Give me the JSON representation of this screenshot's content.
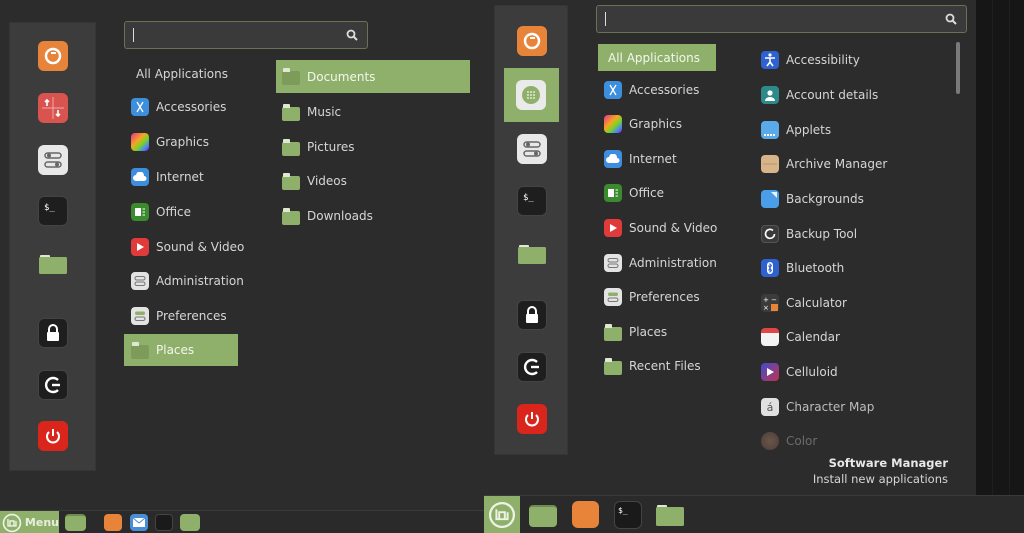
{
  "left_menu": {
    "search": {
      "value": "",
      "placeholder": ""
    },
    "favorites": [
      {
        "name": "firefox"
      },
      {
        "name": "update-manager"
      },
      {
        "name": "system-settings"
      },
      {
        "name": "terminal"
      },
      {
        "name": "files"
      },
      {
        "name": "lock-screen"
      },
      {
        "name": "logout"
      },
      {
        "name": "shutdown"
      }
    ],
    "categories": [
      {
        "label": "All Applications",
        "icon": "none"
      },
      {
        "label": "Accessories",
        "icon": "scissors-icon"
      },
      {
        "label": "Graphics",
        "icon": "graphics-icon"
      },
      {
        "label": "Internet",
        "icon": "cloud-icon"
      },
      {
        "label": "Office",
        "icon": "office-icon"
      },
      {
        "label": "Sound & Video",
        "icon": "play-icon"
      },
      {
        "label": "Administration",
        "icon": "toggles-icon"
      },
      {
        "label": "Preferences",
        "icon": "preferences-icon"
      },
      {
        "label": "Places",
        "icon": "folder-icon",
        "selected": true
      }
    ],
    "places": [
      {
        "label": "Documents",
        "selected": true
      },
      {
        "label": "Music"
      },
      {
        "label": "Pictures"
      },
      {
        "label": "Videos"
      },
      {
        "label": "Downloads"
      }
    ]
  },
  "left_taskbar": {
    "menu_label": "Menu"
  },
  "right_menu": {
    "search": {
      "value": "",
      "placeholder": ""
    },
    "categories": [
      {
        "label": "All Applications",
        "selected": true
      },
      {
        "label": "Accessories"
      },
      {
        "label": "Graphics"
      },
      {
        "label": "Internet"
      },
      {
        "label": "Office"
      },
      {
        "label": "Sound & Video"
      },
      {
        "label": "Administration"
      },
      {
        "label": "Preferences"
      },
      {
        "label": "Places"
      },
      {
        "label": "Recent Files"
      }
    ],
    "apps": [
      {
        "label": "Accessibility"
      },
      {
        "label": "Account details"
      },
      {
        "label": "Applets"
      },
      {
        "label": "Archive Manager"
      },
      {
        "label": "Backgrounds"
      },
      {
        "label": "Backup Tool"
      },
      {
        "label": "Bluetooth"
      },
      {
        "label": "Calculator"
      },
      {
        "label": "Calendar"
      },
      {
        "label": "Celluloid"
      },
      {
        "label": "Character Map"
      },
      {
        "label": "Color"
      }
    ],
    "tooltip": {
      "title": "Software Manager",
      "description": "Install new applications"
    }
  },
  "colors": {
    "accent": "#8fb06a",
    "panel": "#3c3c3c",
    "background": "#2c2c2c"
  }
}
